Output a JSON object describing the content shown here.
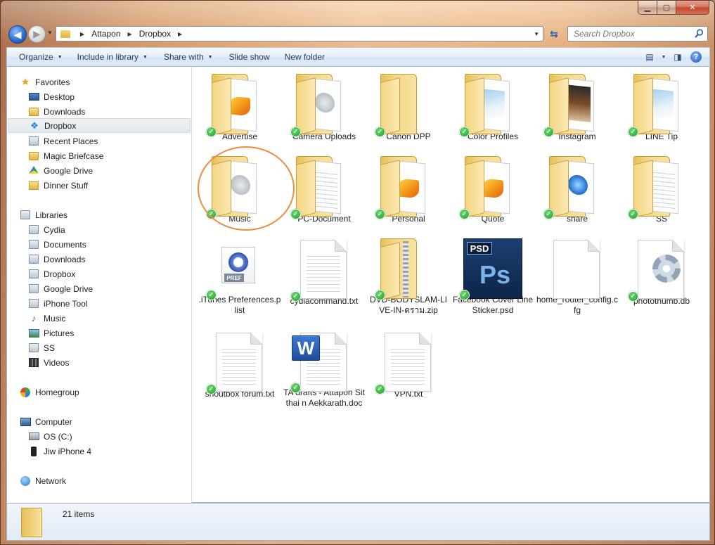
{
  "address": {
    "crumbs": [
      "Attapon",
      "Dropbox"
    ],
    "search_placeholder": "Search Dropbox"
  },
  "toolbar": {
    "organize": "Organize",
    "include_in_library": "Include in library",
    "share_with": "Share with",
    "slide_show": "Slide show",
    "new_folder": "New folder"
  },
  "nav": {
    "favorites": "Favorites",
    "desktop": "Desktop",
    "downloads": "Downloads",
    "dropbox": "Dropbox",
    "recent_places": "Recent Places",
    "magic_briefcase": "Magic Briefcase",
    "google_drive": "Google Drive",
    "dinner_stuff": "Dinner Stuff",
    "libraries": "Libraries",
    "lib_cydia": "Cydia",
    "lib_documents": "Documents",
    "lib_downloads": "Downloads",
    "lib_dropbox": "Dropbox",
    "lib_google_drive": "Google Drive",
    "lib_iphone_tool": "iPhone Tool",
    "lib_music": "Music",
    "lib_pictures": "Pictures",
    "lib_ss": "SS",
    "lib_videos": "Videos",
    "homegroup": "Homegroup",
    "computer": "Computer",
    "os_c": "OS (C:)",
    "jiw_iphone": "Jiw iPhone 4",
    "network": "Network"
  },
  "files": [
    {
      "name": "Advertise",
      "kind": "folder"
    },
    {
      "name": "Camera Uploads",
      "kind": "folder"
    },
    {
      "name": "Canon DPP",
      "kind": "folder"
    },
    {
      "name": "Color Profiles",
      "kind": "folder"
    },
    {
      "name": "Instagram",
      "kind": "folder"
    },
    {
      "name": "LINE Tip",
      "kind": "folder"
    },
    {
      "name": "Music",
      "kind": "folder"
    },
    {
      "name": "PC-Document",
      "kind": "folder"
    },
    {
      "name": "Personal",
      "kind": "folder"
    },
    {
      "name": "Quote",
      "kind": "folder"
    },
    {
      "name": "share",
      "kind": "folder"
    },
    {
      "name": "SS",
      "kind": "folder"
    },
    {
      "name": ".iTunes Preferences.plist",
      "kind": "plist"
    },
    {
      "name": "cydiacommand.txt",
      "kind": "txt"
    },
    {
      "name": "DVD-BODYSLAM-LIVE-IN-ดราม.zip",
      "kind": "zip"
    },
    {
      "name": "Facebook Cover Line Sticker.psd",
      "kind": "psd"
    },
    {
      "name": "home_router_config.cfg",
      "kind": "cfg"
    },
    {
      "name": "photothumb.db",
      "kind": "db"
    },
    {
      "name": "shoutbox forum.txt",
      "kind": "txt"
    },
    {
      "name": "TA drafts - Attapon Sitthai n Aekkarath.doc",
      "kind": "doc"
    },
    {
      "name": "VPN.txt",
      "kind": "txt"
    }
  ],
  "icons": {
    "psd_tag": "PSD",
    "psd_ps": "Ps",
    "word_w": "W",
    "pref_tag": "PREF"
  },
  "details": {
    "item_count": "21 items"
  },
  "colors": {
    "highlight_circle": "#f08a3c",
    "sync_badge": "#1c9a2d"
  }
}
